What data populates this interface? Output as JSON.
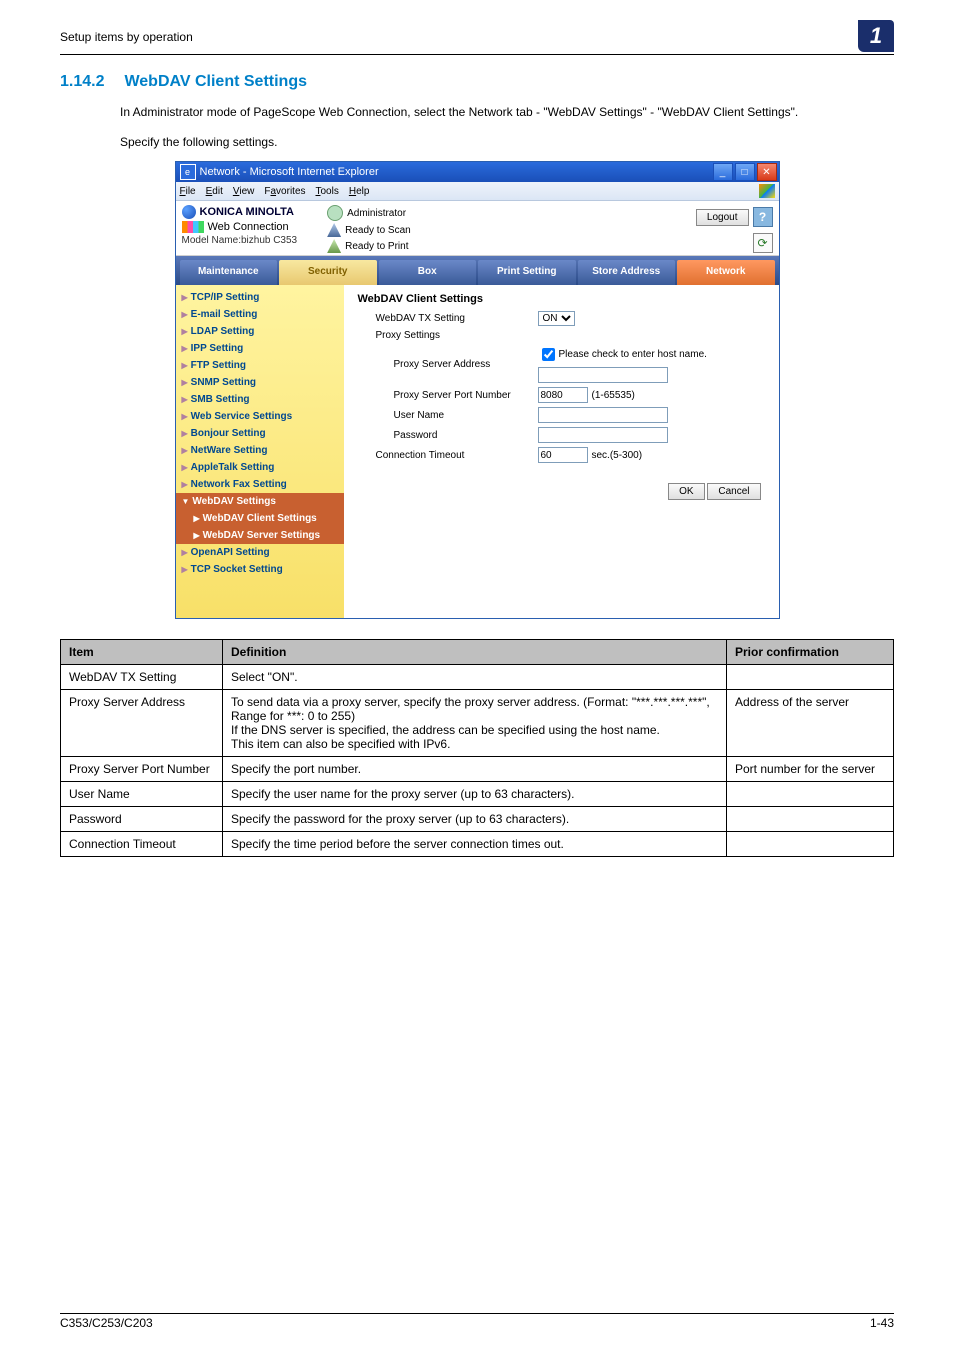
{
  "page": {
    "running_head": "Setup items by operation",
    "chapter_badge": "1",
    "section_number": "1.14.2",
    "section_title": "WebDAV Client Settings",
    "intro_para": "In Administrator mode of PageScope Web Connection, select the Network tab - \"WebDAV Settings\" - \"WebDAV Client Settings\".",
    "intro_para2": "Specify the following settings.",
    "footer_left": "C353/C253/C203",
    "footer_right": "1-43"
  },
  "ie": {
    "title": "Network - Microsoft Internet Explorer",
    "menu": {
      "file": "File",
      "edit": "Edit",
      "view": "View",
      "favorites": "Favorites",
      "tools": "Tools",
      "help": "Help"
    }
  },
  "wc_header": {
    "brand": "KONICA MINOLTA",
    "product": "Web Connection",
    "model": "Model Name:bizhub C353",
    "admin_label": "Administrator",
    "status_scan": "Ready to Scan",
    "status_print": "Ready to Print",
    "logout": "Logout"
  },
  "tabs": {
    "maintenance": "Maintenance",
    "security": "Security",
    "box": "Box",
    "print": "Print Setting",
    "store": "Store Address",
    "network": "Network"
  },
  "sidebar": {
    "items": [
      "TCP/IP Setting",
      "E-mail Setting",
      "LDAP Setting",
      "IPP Setting",
      "FTP Setting",
      "SNMP Setting",
      "SMB Setting",
      "Web Service Settings",
      "Bonjour Setting",
      "NetWare Setting",
      "AppleTalk Setting",
      "Network Fax Setting"
    ],
    "expanded": "WebDAV Settings",
    "sub1": "WebDAV Client Settings",
    "sub2": "WebDAV Server Settings",
    "after": [
      "OpenAPI Setting",
      "TCP Socket Setting"
    ]
  },
  "form": {
    "title": "WebDAV Client Settings",
    "tx_label": "WebDAV TX Setting",
    "tx_value": "ON",
    "proxy_label": "Proxy Settings",
    "addr_label": "Proxy Server Address",
    "hostname_check": "Please check to enter host name.",
    "port_label": "Proxy Server Port Number",
    "port_value": "8080",
    "port_range": "(1-65535)",
    "user_label": "User Name",
    "pass_label": "Password",
    "timeout_label": "Connection Timeout",
    "timeout_value": "60",
    "timeout_unit": "sec.(5-300)",
    "ok": "OK",
    "cancel": "Cancel"
  },
  "table": {
    "h1": "Item",
    "h2": "Definition",
    "h3": "Prior confirmation",
    "rows": [
      {
        "item": "WebDAV TX Setting",
        "def": "Select \"ON\".",
        "prior": ""
      },
      {
        "item": "Proxy Server Address",
        "def": "To send data via a proxy server, specify the proxy server address. (Format: \"***.***.***.***\", Range for ***: 0 to 255)\nIf the DNS server is specified, the address can be specified using the host name.\nThis item can also be specified with IPv6.",
        "prior": "Address of the server"
      },
      {
        "item": "Proxy Server Port Number",
        "def": "Specify the port number.",
        "prior": "Port number for the server"
      },
      {
        "item": "User Name",
        "def": "Specify the user name for the proxy server (up to 63 characters).",
        "prior": ""
      },
      {
        "item": "Password",
        "def": "Specify the password for the proxy server (up to 63 characters).",
        "prior": ""
      },
      {
        "item": "Connection Timeout",
        "def": "Specify the time period before the server connection times out.",
        "prior": ""
      }
    ]
  }
}
